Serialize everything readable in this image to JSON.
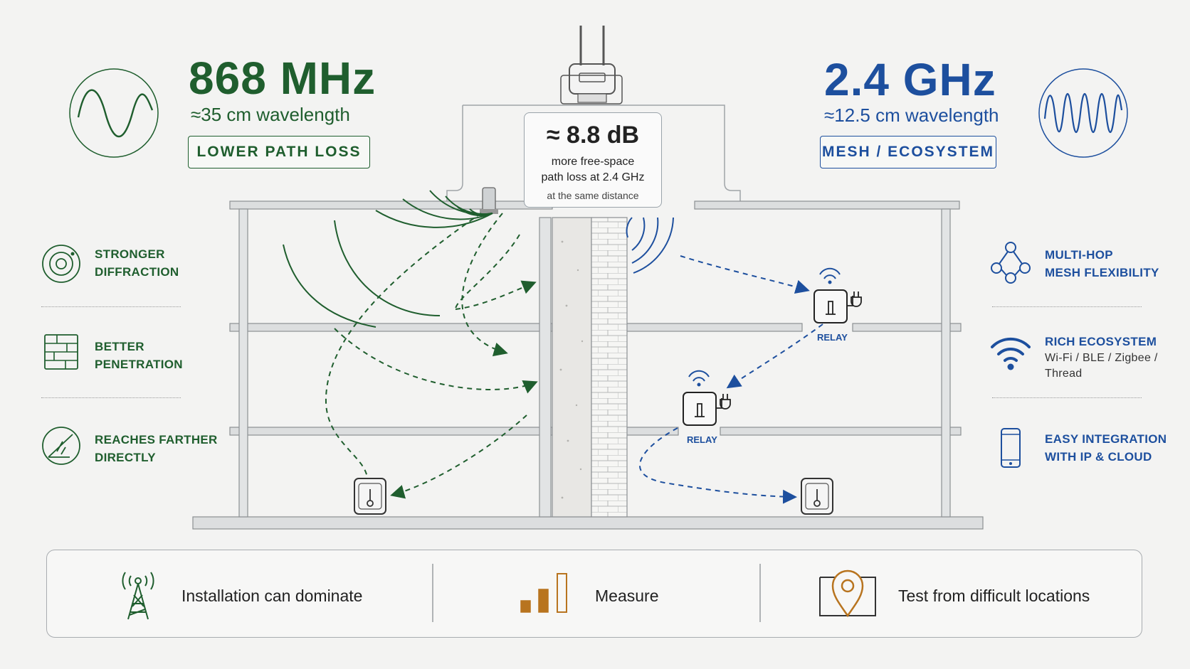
{
  "left": {
    "frequency": "868 MHz",
    "wavelength": "≈35 cm wavelength",
    "tag": "LOWER PATH LOSS",
    "features": [
      {
        "line1": "STRONGER",
        "line2": "DIFFRACTION",
        "icon": "target-icon"
      },
      {
        "line1": "BETTER",
        "line2": "PENETRATION",
        "icon": "brick-wall-icon"
      },
      {
        "line1": "REACHES FARTHER",
        "line2": "DIRECTLY",
        "icon": "direct-path-icon"
      }
    ]
  },
  "right": {
    "frequency": "2.4 GHz",
    "wavelength": "≈12.5 cm wavelength",
    "tag": "MESH / ECOSYSTEM",
    "features": [
      {
        "line1": "MULTI-HOP",
        "line2": "MESH FLEXIBILITY",
        "icon": "mesh-network-icon"
      },
      {
        "line1": "RICH ECOSYSTEM",
        "sub1": "Wi-Fi / BLE / Zigbee /",
        "sub2": "Thread",
        "icon": "wifi-icon"
      },
      {
        "line1": "EASY INTEGRATION",
        "line2": "WITH IP & CLOUD",
        "icon": "smartphone-icon"
      }
    ]
  },
  "callout": {
    "value": "≈ 8.8 dB",
    "line1": "more free-space",
    "line2": "path loss at 2.4 GHz",
    "note": "at the same distance"
  },
  "diagram": {
    "relay_labels": [
      "RELAY",
      "RELAY"
    ]
  },
  "bottom": {
    "items": [
      {
        "label": "Installation can dominate",
        "icon": "radio-tower-icon"
      },
      {
        "label": "Measure",
        "icon": "signal-bars-icon"
      },
      {
        "label": "Test from difficult locations",
        "icon": "map-pin-icon"
      }
    ]
  },
  "colors": {
    "green": "#1f5e2e",
    "blue": "#1d4f9e",
    "orange": "#b8741f",
    "structure": "#9ea2a5"
  }
}
